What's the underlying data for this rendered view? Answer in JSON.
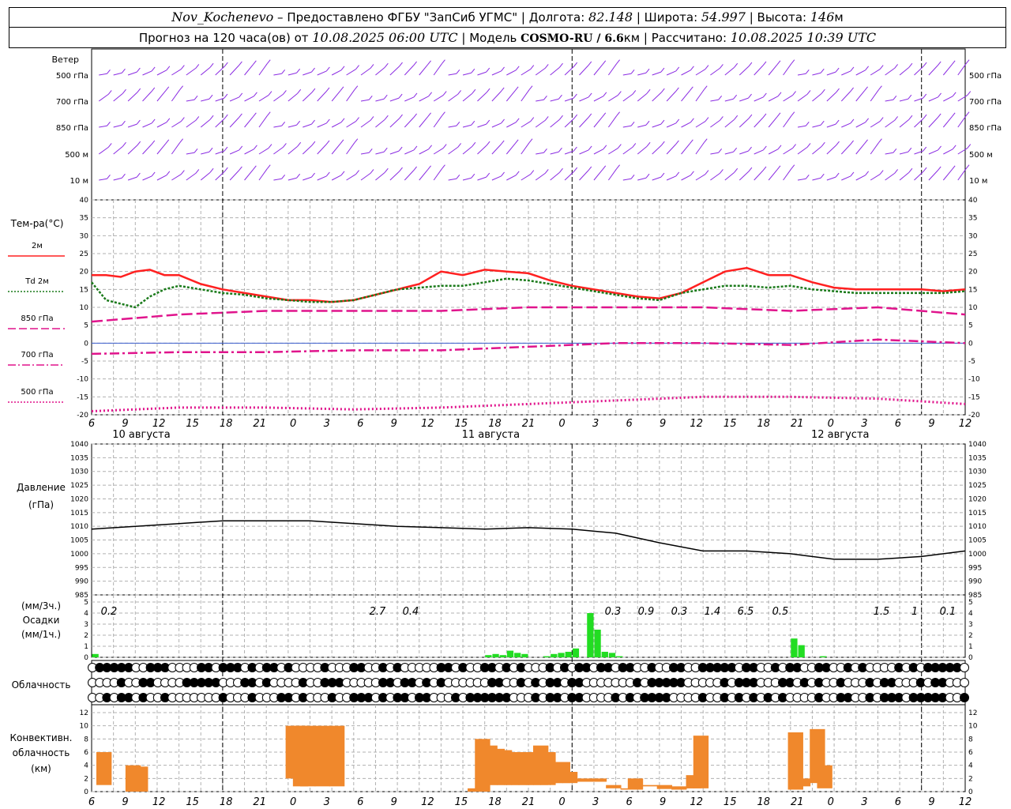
{
  "header": {
    "station": "Nov_Kochenevo",
    "provider": "– Предоставлено ФГБУ \"ЗапСиб УГМС\"",
    "lon_label": "Долгота:",
    "lon_value": "82.148",
    "lat_label": "Широта:",
    "lat_value": "54.997",
    "alt_label": "Высота:",
    "alt_value": "146",
    "alt_unit": "м",
    "forecast_label": "Прогноз на 120 часа(ов) от",
    "forecast_time": "10.08.2025 06:00 UTC",
    "model_label": "Модель",
    "model_value": "COSMO-RU / 6.6",
    "model_unit": "км",
    "calc_label": "Рассчитано:",
    "calc_time": "10.08.2025 10:39 UTC"
  },
  "wind_panel": {
    "title": "Ветер",
    "levels": [
      "500 гПа",
      "700 гПа",
      "850 гПа",
      "500 м",
      "10 м"
    ],
    "color": "#8a2be2"
  },
  "temp_panel": {
    "title": "Тем-ра(°C)",
    "legend": [
      {
        "label": "2м",
        "color": "#ff2020",
        "style": "solid"
      },
      {
        "label": "Td 2м",
        "color": "#1a7a1a",
        "style": "dotted"
      },
      {
        "label": "850 гПа",
        "color": "#e0148c",
        "style": "dashed"
      },
      {
        "label": "700 гПа",
        "color": "#e0148c",
        "style": "dashdot"
      },
      {
        "label": "500 гПа",
        "color": "#e0148c",
        "style": "dotted"
      }
    ],
    "yticks": [
      "40",
      "35",
      "30",
      "25",
      "20",
      "15",
      "10",
      "5",
      "0",
      "-5",
      "-10",
      "-15",
      "-20"
    ]
  },
  "time_axis": {
    "hours": [
      "6",
      "9",
      "12",
      "15",
      "18",
      "21",
      "0",
      "3",
      "6",
      "9",
      "12",
      "15",
      "18",
      "21",
      "0",
      "3",
      "6",
      "9",
      "12",
      "15",
      "18",
      "21",
      "0",
      "3",
      "6",
      "9",
      "12"
    ],
    "days": [
      "10 августа",
      "11 августа",
      "12 августа"
    ]
  },
  "pressure_panel": {
    "title": "Давление",
    "unit": "(гПа)",
    "yticks": [
      "1040",
      "1035",
      "1030",
      "1025",
      "1020",
      "1015",
      "1010",
      "1005",
      "1000",
      "995",
      "990",
      "985"
    ]
  },
  "precip_panel": {
    "unit_top": "(мм/3ч.)",
    "title": "Осадки",
    "unit_bottom": "(мм/1ч.)",
    "yticks": [
      "5",
      "4",
      "3",
      "2",
      "1",
      "0"
    ],
    "totals": [
      "0.2",
      "2.7",
      "0.4",
      "0.3",
      "0.9",
      "0.3",
      "1.4",
      "6.5",
      "0.5",
      "1.5",
      "1",
      "0.1"
    ],
    "color": "#22dd22"
  },
  "cloud_panel": {
    "title": "Облачность"
  },
  "conv_panel": {
    "title_1": "Конвективн.",
    "title_2": "облачность",
    "unit": "(км)",
    "yticks": [
      "12",
      "10",
      "8",
      "6",
      "4",
      "2",
      "0"
    ],
    "color": "#f0882c"
  },
  "chart_data": [
    {
      "type": "line",
      "title": "Тем-ра(°C)",
      "x_unit": "hours since 10.08.2025 06:00 UTC",
      "ylim": [
        -20,
        40
      ],
      "grid": true,
      "series": [
        {
          "name": "2м",
          "x": [
            0,
            2,
            4,
            6,
            8,
            10,
            12,
            15,
            18,
            21,
            24,
            27,
            30,
            33,
            36,
            39,
            42,
            45,
            48,
            51,
            54,
            57,
            60,
            63,
            66,
            69,
            72,
            75,
            78,
            81,
            84,
            87,
            90,
            93,
            96,
            99,
            102,
            105,
            108,
            111,
            114,
            117,
            120
          ],
          "values": [
            19,
            19,
            18.5,
            20,
            20.5,
            19,
            19,
            16.5,
            15,
            14,
            13,
            12,
            12,
            11.5,
            12,
            13.5,
            15,
            16.5,
            20,
            19,
            20.5,
            20,
            19.5,
            17.5,
            16,
            15,
            14,
            13,
            12.5,
            14,
            17,
            20,
            21,
            19,
            19,
            17,
            15.5,
            15,
            15,
            15,
            15,
            14.5,
            15
          ]
        },
        {
          "name": "Td 2м",
          "x": [
            0,
            2,
            4,
            6,
            8,
            10,
            12,
            15,
            18,
            21,
            24,
            27,
            30,
            33,
            36,
            39,
            42,
            45,
            48,
            51,
            54,
            57,
            60,
            63,
            66,
            69,
            72,
            75,
            78,
            81,
            84,
            87,
            90,
            93,
            96,
            99,
            102,
            105,
            108,
            111,
            114,
            117,
            120
          ],
          "values": [
            17,
            12,
            11,
            10,
            13,
            15,
            16,
            15,
            14,
            13.5,
            12.5,
            12,
            11.5,
            11.5,
            12,
            13.5,
            15,
            15.5,
            16,
            16,
            17,
            18,
            17.5,
            16.5,
            15.5,
            14.5,
            13.5,
            12.5,
            12,
            14,
            15,
            16,
            16,
            15.5,
            16,
            15,
            14.5,
            14,
            14,
            14,
            14,
            14,
            14.5
          ]
        },
        {
          "name": "850 гПа",
          "x": [
            0,
            12,
            24,
            36,
            48,
            60,
            72,
            84,
            96,
            108,
            120
          ],
          "values": [
            6,
            8,
            9,
            9,
            9,
            10,
            10,
            10,
            9,
            10,
            8
          ]
        },
        {
          "name": "700 гПа",
          "x": [
            0,
            12,
            24,
            36,
            48,
            60,
            72,
            84,
            96,
            108,
            120
          ],
          "values": [
            -3,
            -2.5,
            -2.5,
            -2,
            -2,
            -1,
            0,
            0,
            -0.5,
            1,
            0
          ]
        },
        {
          "name": "500 гПа",
          "x": [
            0,
            12,
            24,
            36,
            48,
            60,
            72,
            84,
            96,
            108,
            120
          ],
          "values": [
            -19,
            -18,
            -18,
            -18.5,
            -18,
            -17,
            -16,
            -15,
            -15,
            -15.5,
            -17
          ]
        }
      ]
    },
    {
      "type": "line",
      "title": "Давление",
      "ylabel": "(гПа)",
      "ylim": [
        985,
        1040
      ],
      "grid": true,
      "series": [
        {
          "x": [
            0,
            6,
            12,
            18,
            24,
            30,
            36,
            42,
            48,
            54,
            60,
            66,
            72,
            78,
            84,
            90,
            96,
            102,
            108,
            114,
            120
          ],
          "values": [
            1009,
            1010,
            1011,
            1012,
            1012,
            1012,
            1011,
            1010,
            1009.5,
            1009,
            1009.5,
            1009,
            1007.5,
            1004,
            1001,
            1001,
            1000,
            998,
            998,
            999,
            1001
          ]
        }
      ]
    },
    {
      "type": "bar",
      "title": "Осадки",
      "ylabel": "(мм/1ч.)",
      "ylim": [
        0,
        5
      ],
      "series": [
        {
          "x": [
            0,
            24,
            25,
            26,
            30,
            31,
            32,
            33,
            54,
            55,
            56,
            57,
            58,
            59,
            60,
            62,
            63,
            64,
            65,
            66,
            68,
            69,
            70,
            71,
            72,
            73,
            74,
            75,
            96,
            97,
            100
          ],
          "values": [
            0.3,
            0,
            0,
            0,
            0,
            0,
            0,
            0,
            0.2,
            0.3,
            0.2,
            0.6,
            0.4,
            0.3,
            0,
            0.1,
            0.3,
            0.4,
            0.5,
            0.8,
            4.0,
            2.5,
            0.5,
            0.4,
            0.1,
            0,
            0,
            0,
            1.7,
            1.1,
            0.1
          ]
        }
      ]
    },
    {
      "type": "bar",
      "title": "Конвективн. облачность (км)",
      "ylim": [
        0,
        12
      ],
      "series": [
        {
          "x": [
            0,
            4,
            5,
            26,
            27,
            28,
            30,
            32,
            51,
            52,
            53,
            54,
            55,
            56,
            57,
            58,
            59,
            60,
            61,
            62,
            63,
            64,
            66,
            68,
            69,
            70,
            71,
            72,
            73,
            74,
            75,
            76,
            77,
            78,
            79,
            80,
            81,
            82,
            95,
            96,
            98,
            99
          ],
          "bottoms": [
            1,
            0,
            0,
            2,
            0.8,
            0.8,
            0.8,
            0.8,
            0,
            0,
            1,
            1,
            1,
            1,
            1,
            1,
            1,
            1,
            1,
            1.3,
            1.3,
            1.3,
            1.5,
            1.5,
            1.2,
            0.5,
            0.5,
            0.3,
            0.3,
            1.0,
            0.8,
            0.8,
            0.4,
            0.6,
            0.3,
            0.5,
            0.5,
            0.5,
            0.3,
            0.8,
            1.3,
            0.5
          ],
          "tops": [
            6,
            4,
            3.8,
            10,
            10,
            10,
            10,
            10,
            0.5,
            8,
            7,
            6.5,
            6.3,
            6,
            6,
            6,
            6,
            7,
            6,
            1.5,
            4.5,
            3,
            2,
            2,
            1,
            1,
            0.5,
            0.5,
            2,
            1,
            1,
            0.8,
            1,
            0.5,
            0.8,
            0.7,
            2.5,
            8.5,
            9,
            2,
            9.5,
            4
          ]
        }
      ]
    }
  ]
}
